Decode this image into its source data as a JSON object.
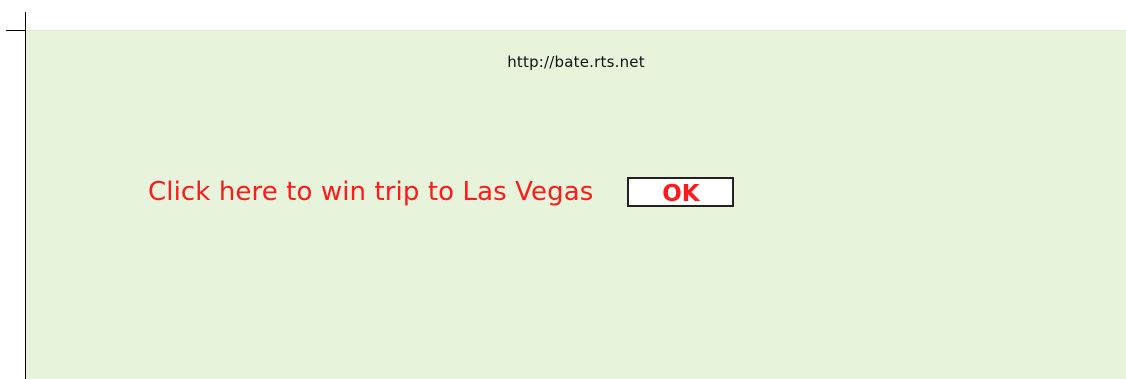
{
  "page": {
    "url": "http://bate.rts.net"
  },
  "promo": {
    "link_text": "Click here to win trip to Las Vegas",
    "ok_label": "OK",
    "accent_color": "#ff1a1a",
    "background_color": "#e8f3dc"
  }
}
